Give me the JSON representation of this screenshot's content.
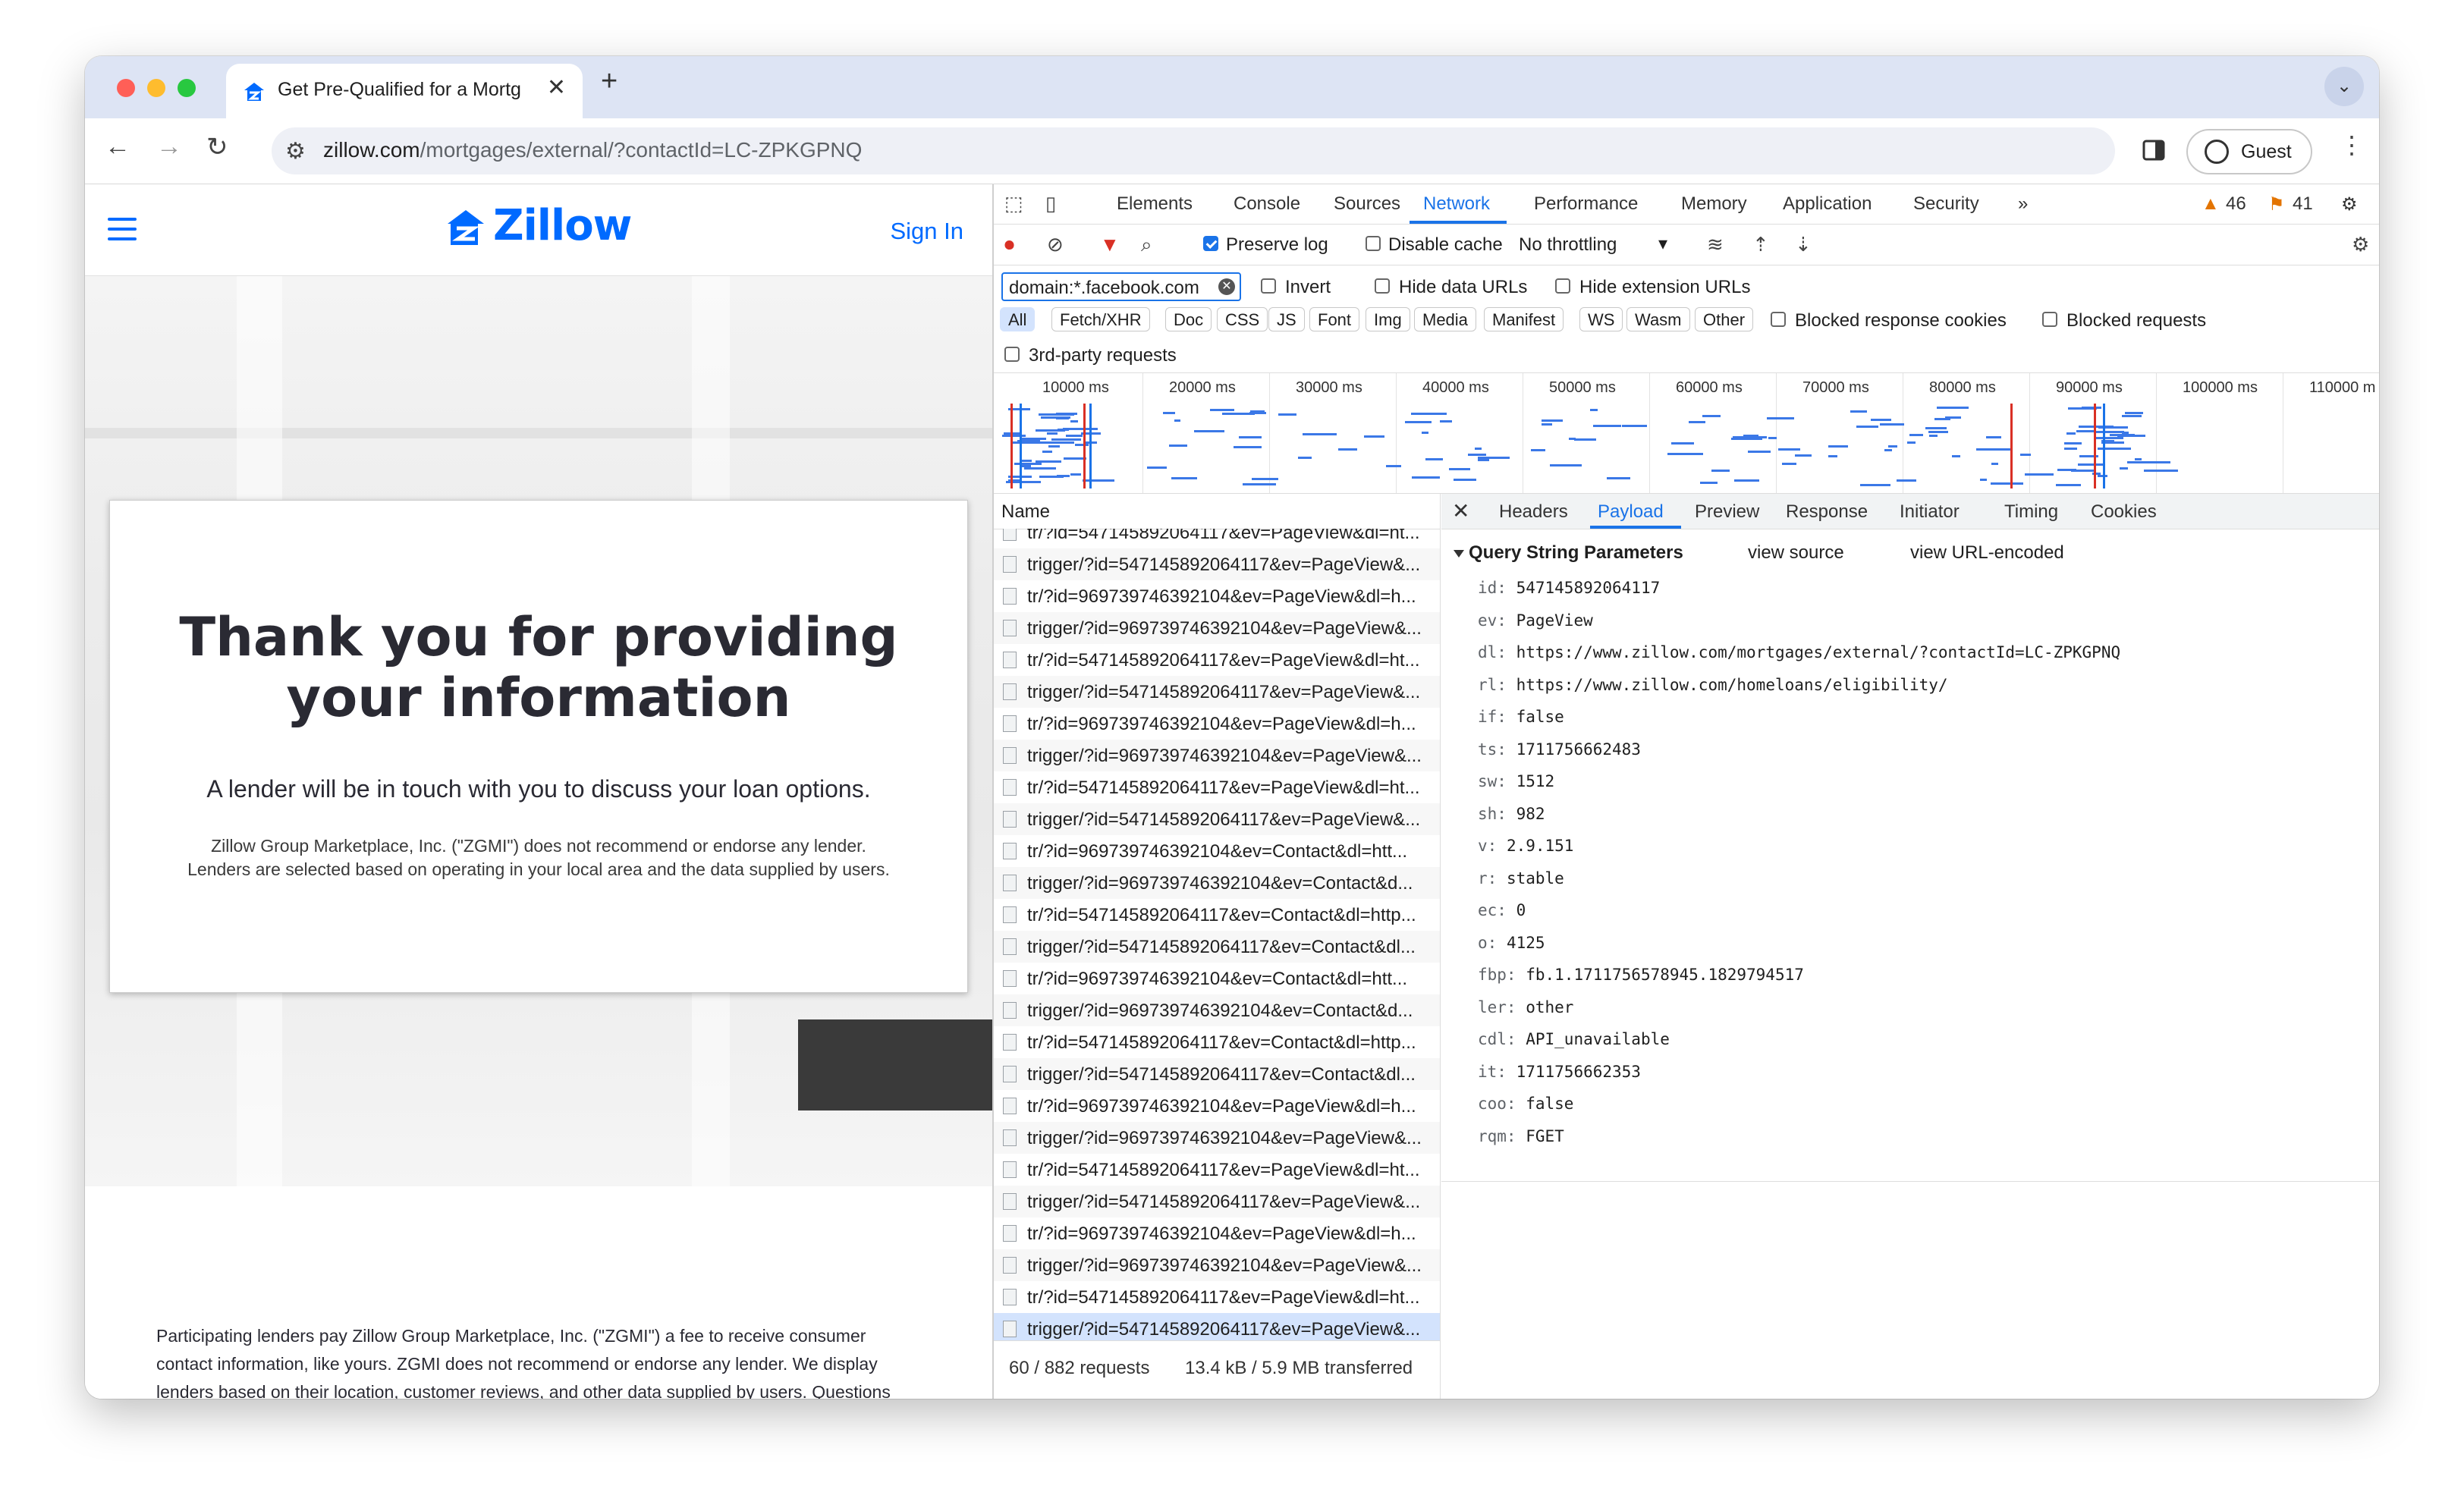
{
  "tab": {
    "title": "Get Pre-Qualified for a Mortg",
    "close": "✕",
    "new": "+"
  },
  "omnibox": {
    "host": "zillow.com",
    "path": "/mortgages/external/?contactId=LC-ZPKGPNQ"
  },
  "profile": {
    "label": "Guest"
  },
  "page": {
    "logo": "Zillow",
    "signin": "Sign In",
    "heading": "Thank you for providing your information",
    "sub": "A lender will be in touch with you to discuss your loan options.",
    "fine1": "Zillow Group Marketplace, Inc. (\"ZGMI\") does not recommend or endorse any lender.",
    "fine2": "Lenders are selected based on operating in your local area and the data supplied by users.",
    "disclaimer": "Participating lenders pay Zillow Group Marketplace, Inc. (\"ZGMI\") a fee to receive consumer contact information, like yours. ZGMI does not recommend or endorse any lender. We display lenders based on their location, customer reviews, and other data supplied by users. Questions you answer during the Home Journey questionnaire provide ZGMI with preliminary, personalized data about your circumstances and current interest"
  },
  "devtools": {
    "tabs": [
      "Elements",
      "Console",
      "Sources",
      "Network",
      "Performance",
      "Memory",
      "Application",
      "Security"
    ],
    "more": "»",
    "warnings": "46",
    "issues": "41",
    "preserve_log": "Preserve log",
    "disable_cache": "Disable cache",
    "throttling": "No throttling",
    "filter": "domain:*.facebook.com",
    "invert": "Invert",
    "hide_data": "Hide data URLs",
    "hide_ext": "Hide extension URLs",
    "types": [
      "All",
      "Fetch/XHR",
      "Doc",
      "CSS",
      "JS",
      "Font",
      "Img",
      "Media",
      "Manifest",
      "WS",
      "Wasm",
      "Other"
    ],
    "blocked_cookies": "Blocked response cookies",
    "blocked_requests": "Blocked requests",
    "third_party": "3rd-party requests",
    "ticks": [
      "10000 ms",
      "20000 ms",
      "30000 ms",
      "40000 ms",
      "50000 ms",
      "60000 ms",
      "70000 ms",
      "80000 ms",
      "90000 ms",
      "100000 ms",
      "110000 m"
    ],
    "name_header": "Name",
    "rows": [
      "tr/?id=547145892064117&ev=PageView&dl=ht...",
      "trigger/?id=547145892064117&ev=PageView&...",
      "tr/?id=969739746392104&ev=PageView&dl=h...",
      "trigger/?id=969739746392104&ev=PageView&...",
      "tr/?id=547145892064117&ev=PageView&dl=ht...",
      "trigger/?id=547145892064117&ev=PageView&...",
      "tr/?id=969739746392104&ev=PageView&dl=h...",
      "trigger/?id=969739746392104&ev=PageView&...",
      "tr/?id=547145892064117&ev=PageView&dl=ht...",
      "trigger/?id=547145892064117&ev=PageView&...",
      "tr/?id=969739746392104&ev=Contact&dl=htt...",
      "trigger/?id=969739746392104&ev=Contact&d...",
      "tr/?id=547145892064117&ev=Contact&dl=http...",
      "trigger/?id=547145892064117&ev=Contact&dl...",
      "tr/?id=969739746392104&ev=Contact&dl=htt...",
      "trigger/?id=969739746392104&ev=Contact&d...",
      "tr/?id=547145892064117&ev=Contact&dl=http...",
      "trigger/?id=547145892064117&ev=Contact&dl...",
      "tr/?id=969739746392104&ev=PageView&dl=h...",
      "trigger/?id=969739746392104&ev=PageView&...",
      "tr/?id=547145892064117&ev=PageView&dl=ht...",
      "trigger/?id=547145892064117&ev=PageView&...",
      "tr/?id=969739746392104&ev=PageView&dl=h...",
      "trigger/?id=969739746392104&ev=PageView&...",
      "tr/?id=547145892064117&ev=PageView&dl=ht...",
      "trigger/?id=547145892064117&ev=PageView&..."
    ],
    "footer_requests": "60 / 882 requests",
    "footer_transfer": "13.4 kB / 5.9 MB transferred",
    "detail_tabs": [
      "Headers",
      "Payload",
      "Preview",
      "Response",
      "Initiator",
      "Timing",
      "Cookies"
    ],
    "query_heading": "Query String Parameters",
    "view_source": "view source",
    "view_encoded": "view URL-encoded",
    "params": [
      {
        "k": "id:",
        "v": "547145892064117"
      },
      {
        "k": "ev:",
        "v": "PageView"
      },
      {
        "k": "dl:",
        "v": "https://www.zillow.com/mortgages/external/?contactId=LC-ZPKGPNQ"
      },
      {
        "k": "rl:",
        "v": "https://www.zillow.com/homeloans/eligibility/"
      },
      {
        "k": "if:",
        "v": "false"
      },
      {
        "k": "ts:",
        "v": "1711756662483"
      },
      {
        "k": "sw:",
        "v": "1512"
      },
      {
        "k": "sh:",
        "v": "982"
      },
      {
        "k": "v:",
        "v": "2.9.151"
      },
      {
        "k": "r:",
        "v": "stable"
      },
      {
        "k": "ec:",
        "v": "0"
      },
      {
        "k": "o:",
        "v": "4125"
      },
      {
        "k": "fbp:",
        "v": "fb.1.1711756578945.1829794517"
      },
      {
        "k": "ler:",
        "v": "other"
      },
      {
        "k": "cdl:",
        "v": "API_unavailable"
      },
      {
        "k": "it:",
        "v": "1711756662353"
      },
      {
        "k": "coo:",
        "v": "false"
      },
      {
        "k": "rqm:",
        "v": "FGET"
      }
    ]
  }
}
